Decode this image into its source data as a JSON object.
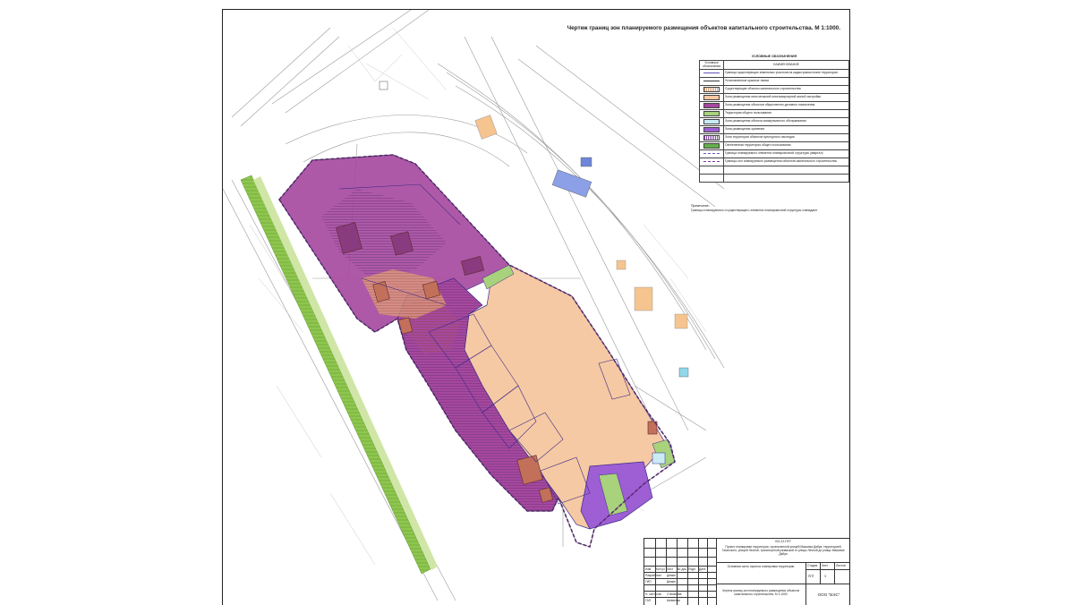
{
  "drawing": {
    "title": "Чертеж границ зон планируемого размещения объектов капитального строительства. М 1:1000."
  },
  "legend": {
    "header": "УСЛОВНЫЕ ОБОЗНАЧЕНИЯ",
    "col_symbol": "Условные обозначения",
    "col_name": "НАИМЕНОВАНИЕ",
    "items": [
      {
        "style": "line",
        "color": "#6a55b8",
        "label": "Граница существующих земельных участков на кадастровом плане территории"
      },
      {
        "style": "line",
        "color": "#3a3a3a",
        "label": "Установленные красные линии"
      },
      {
        "style": "hatch",
        "color": "#d7a079",
        "label": "Существующие объекты капитального строительства"
      },
      {
        "style": "fill",
        "color": "#f5c9a3",
        "label": "Зона размещения многоэтажной многоквартирной жилой застройки"
      },
      {
        "style": "fill",
        "color": "#a6489e",
        "label": "Зона размещения объектов общественно-делового назначения"
      },
      {
        "style": "fill",
        "color": "#a8d27b",
        "label": "Территория общего пользования"
      },
      {
        "style": "fill",
        "color": "#c9ecf4",
        "label": "Зона размещения объекта коммунального обслуживания"
      },
      {
        "style": "fill",
        "color": "#9e5fd4",
        "label": "Зона размещения хранения"
      },
      {
        "style": "hatch",
        "color": "#8c4fb0",
        "label": "Зона территории объектов культурного наследия"
      },
      {
        "style": "fill",
        "color": "#63b04a",
        "label": "Озелененная территория общего пользования"
      },
      {
        "style": "dash",
        "color": "#6a55b8",
        "label": "Граница планируемого элемента планировочной структуры (квартал)"
      },
      {
        "style": "dash",
        "color": "#7a3a9a",
        "label": "Границы зон планируемого размещения объектов капитального строительства"
      },
      {
        "style": "none",
        "color": "#ffffff",
        "label": ""
      },
      {
        "style": "none",
        "color": "#ffffff",
        "label": ""
      }
    ]
  },
  "note": {
    "title": "Примечание:",
    "text": "Границы планируемого и существующего элемента планировочной структуры совпадают"
  },
  "stamp": {
    "doc_code": "001-22-ППТ",
    "project_title": "Проект планировки территории, ограниченной улицей Максима Дябуа, территорией Таганского, улицей Лесной, транспортной развязкой от улицы Лесной до улицы Максима Дябуа",
    "section_title": "Основная часть проекта планировки территории",
    "sheet_title": "Чертеж границ зон планируемого размещения объектов капитального строительства. М 1:1000",
    "company": "ООО \"БЭС\"",
    "col_headers": [
      "Изм.",
      "Кол.уч",
      "Лист",
      "№ док.",
      "Подп.",
      "Дата"
    ],
    "roles": [
      "Разработал",
      "ГИП",
      "Н. контроль",
      "ГАП"
    ],
    "names": [
      "Демин",
      "Демин",
      "Степанова",
      "Шевченко"
    ],
    "stage_headers": [
      "Стадия",
      "Лист",
      "Листов"
    ],
    "stage_values": [
      "ППТ",
      "3",
      ""
    ]
  },
  "map": {
    "zones": [
      {
        "name": "Зона размещения объектов общественно-делового назначения",
        "color": "#a6489e"
      },
      {
        "name": "Зона размещения многоэтажной многоквартирной жилой застройки",
        "color": "#f5c9a3"
      },
      {
        "name": "Зона размещения хранения",
        "color": "#9e5fd4"
      },
      {
        "name": "Территория общего пользования",
        "color": "#a8d27b"
      }
    ]
  }
}
